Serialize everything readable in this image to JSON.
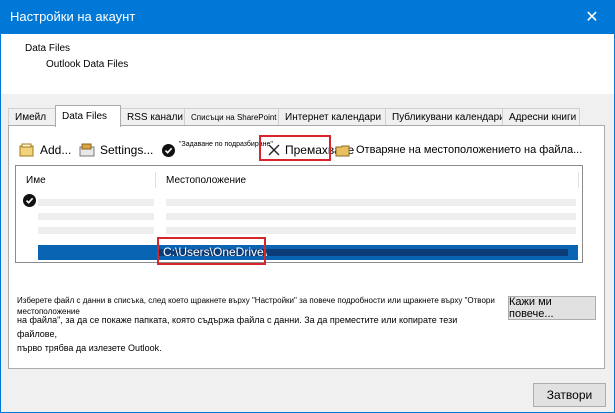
{
  "window": {
    "title": "Настройки на акаунт"
  },
  "header": {
    "section_title": "Data Files",
    "section_subtitle": "Outlook Data Files"
  },
  "tabs": [
    {
      "label": "Имейл"
    },
    {
      "label": "Data Files"
    },
    {
      "label": "RSS канали"
    },
    {
      "label": "Списъци на SharePoint"
    },
    {
      "label": "Интернет календари"
    },
    {
      "label": "Публикувани календари"
    },
    {
      "label": "Адресни книги"
    }
  ],
  "toolbar": {
    "add_label": "Add...",
    "settings_label": "Settings...",
    "set_default_label": "\"Задаване по подразбиране\"",
    "remove_label": "Премахване",
    "open_location_label": "Отваряне на местоположението на файла..."
  },
  "list": {
    "col_name": "Име",
    "col_location": "Местоположение",
    "selected_path": "C:\\Users\\OneDrive\\"
  },
  "info": {
    "line1": "Изберете файл с данни в списъка, след което щракнете върху \"Настройки\" за повече подробности или щракнете върху \"Отвори местоположение",
    "line2": "на файла\", за да се покаже папката, която съдържа файла с данни. За да преместите или копирате тези файлове,",
    "line3": "първо трябва да излезете Outlook."
  },
  "buttons": {
    "tell_more": "Кажи ми повече...",
    "close": "Затвори"
  },
  "colors": {
    "titlebar": "#0078d7",
    "selection": "#0a64b4",
    "highlight": "#d7262b"
  }
}
